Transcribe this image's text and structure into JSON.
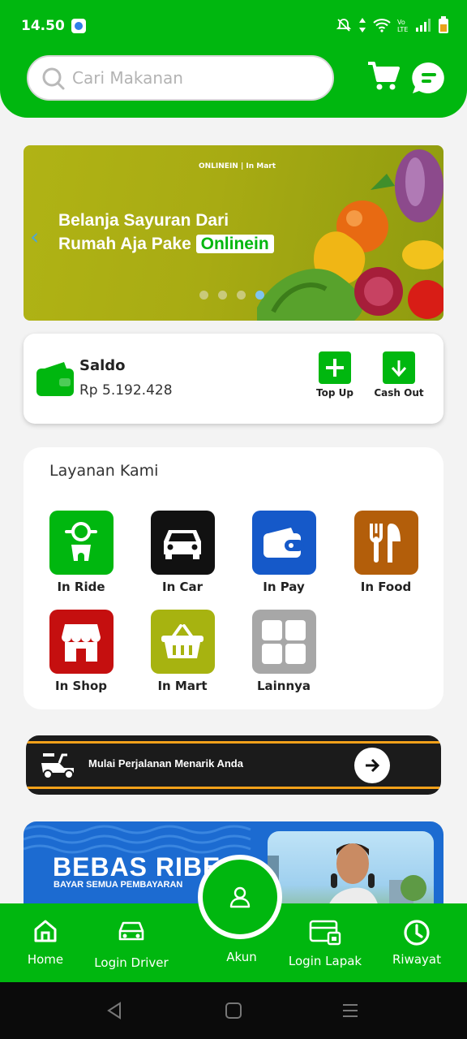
{
  "status_bar": {
    "time": "14.50"
  },
  "header": {
    "search_placeholder": "Cari Makanan",
    "icons": [
      "search-icon",
      "cart-icon",
      "chat-icon"
    ]
  },
  "banner": {
    "brand": "ONLINEIN | In Mart",
    "title_line1": "Belanja Sayuran Dari",
    "title_line2_prefix": "Rumah Aja Pake",
    "title_highlight": "Onlinein",
    "slide_count": 4,
    "active_slide": 4
  },
  "saldo": {
    "label": "Saldo",
    "value": "Rp 5.192.428",
    "topup_label": "Top Up",
    "cashout_label": "Cash Out"
  },
  "layanan": {
    "title": "Layanan Kami",
    "items": [
      {
        "label": "In Ride",
        "color": "#00b70f",
        "icon": "scooter-icon"
      },
      {
        "label": "In Car",
        "color": "#111111",
        "icon": "car-icon"
      },
      {
        "label": "In Pay",
        "color": "#1559c9",
        "icon": "wallet-icon"
      },
      {
        "label": "In Food",
        "color": "#b35e0a",
        "icon": "fork-knife-icon"
      },
      {
        "label": "In Shop",
        "color": "#c50f0f",
        "icon": "shop-icon"
      },
      {
        "label": "In Mart",
        "color": "#a7b310",
        "icon": "basket-icon"
      },
      {
        "label": "Lainnya",
        "color": "#a7a7a7",
        "icon": "grid-icon"
      }
    ]
  },
  "promo": {
    "text": "Mulai Perjalanan Menarik Anda"
  },
  "banner2": {
    "title": "BEBAS RIBE",
    "subtitle": "BAYAR SEMUA PEMBAYARAN"
  },
  "bottom_nav": {
    "items": [
      {
        "label": "Home",
        "icon": "home-icon"
      },
      {
        "label": "Login Driver",
        "icon": "car-outline-icon"
      },
      {
        "label": "Akun",
        "icon": "user-icon"
      },
      {
        "label": "Login Lapak",
        "icon": "store-card-icon"
      },
      {
        "label": "Riwayat",
        "icon": "history-icon"
      }
    ]
  },
  "colors": {
    "primary": "#00b70f",
    "accent_orange": "#f3a11a",
    "banner_blue": "#1c6bd1"
  }
}
